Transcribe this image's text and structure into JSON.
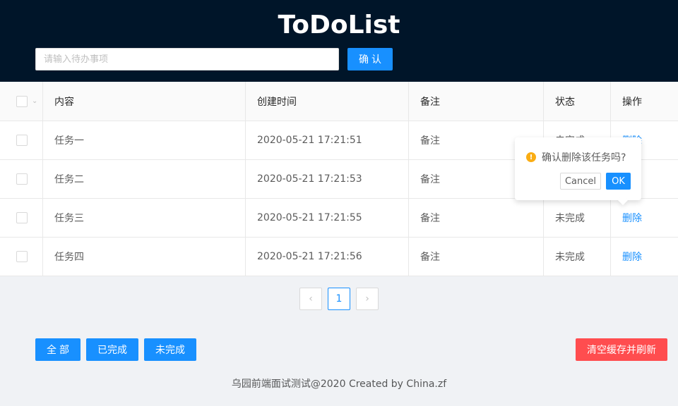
{
  "header": {
    "title": "ToDoList",
    "input_placeholder": "请输入待办事项",
    "confirm_label": "确认"
  },
  "table": {
    "columns": [
      "内容",
      "创建时间",
      "备注",
      "状态",
      "操作"
    ],
    "rows": [
      {
        "content": "任务一",
        "time": "2020-05-21 17:21:51",
        "note": "备注",
        "status": "未完成",
        "action": "删除"
      },
      {
        "content": "任务二",
        "time": "2020-05-21 17:21:53",
        "note": "备注",
        "status": "",
        "action": ""
      },
      {
        "content": "任务三",
        "time": "2020-05-21 17:21:55",
        "note": "备注",
        "status": "未完成",
        "action": "删除"
      },
      {
        "content": "任务四",
        "time": "2020-05-21 17:21:56",
        "note": "备注",
        "status": "未完成",
        "action": "删除"
      }
    ]
  },
  "pagination": {
    "prev_icon": "chevron-left-icon",
    "current_page": "1",
    "next_icon": "chevron-right-icon"
  },
  "filters": {
    "all_label": "全部",
    "done_label": "已完成",
    "undone_label": "未完成"
  },
  "clear_label": "清空缓存并刷新",
  "popconfirm": {
    "message": "确认删除该任务吗?",
    "cancel_label": "Cancel",
    "ok_label": "OK"
  },
  "footer": {
    "text": "乌园前端面试测试@2020 Created by China.zf"
  },
  "colors": {
    "header_bg": "#001529",
    "primary": "#1890ff",
    "danger": "#ff4d4f",
    "warning": "#faad14"
  }
}
